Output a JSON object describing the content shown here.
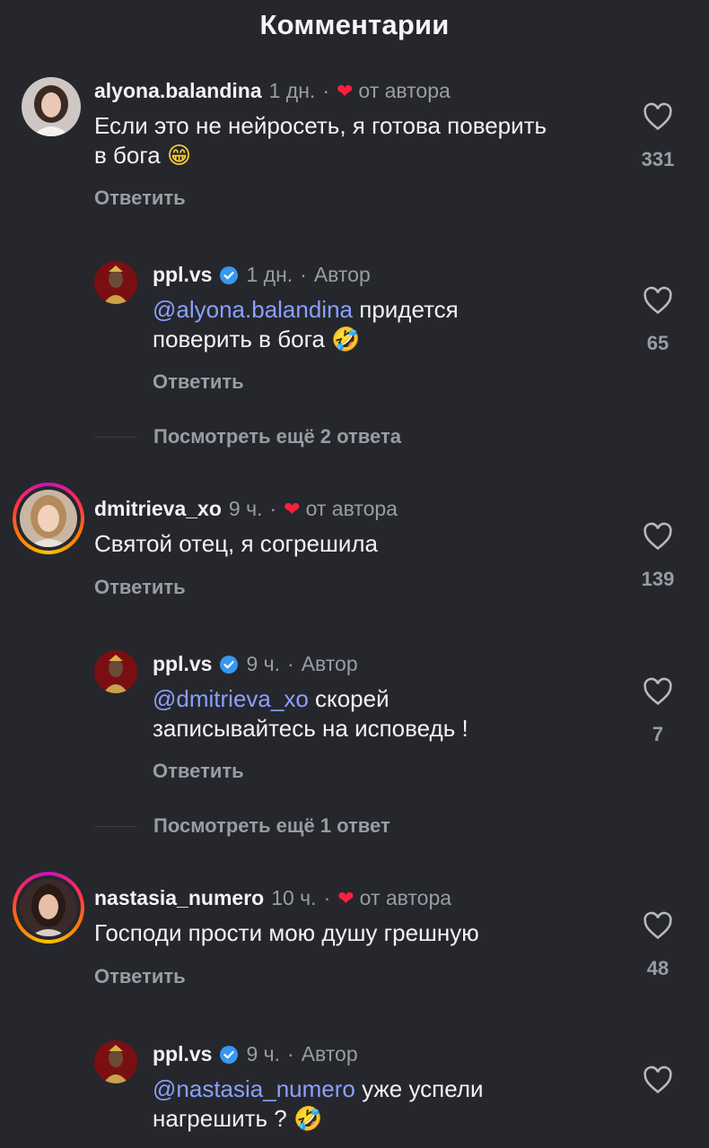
{
  "header": {
    "title": "Комментарии"
  },
  "labels": {
    "reply": "Ответить",
    "author": "Автор",
    "from_author": "от автора"
  },
  "comments": [
    {
      "user": "alyona.balandina",
      "time": "1 дн.",
      "liked_by_author": true,
      "text_line1": "Если это не нейросеть, я готова поверить",
      "text_line2": "в бога",
      "emoji": "😁",
      "likes": "331",
      "reply": {
        "user": "ppl.vs",
        "time": "1 дн.",
        "mention": "@alyona.balandina",
        "text_line1_rest": " придется",
        "text_line2": "поверить в бога",
        "emoji": "🤣",
        "likes": "65"
      },
      "more": "Посмотреть ещё 2 ответа"
    },
    {
      "user": "dmitrieva_xo",
      "time": "9 ч.",
      "liked_by_author": true,
      "text_line1": "Святой отец, я согрешила",
      "likes": "139",
      "reply": {
        "user": "ppl.vs",
        "time": "9 ч.",
        "mention": "@dmitrieva_xo",
        "text_line1_rest": " скорей",
        "text_line2": "записывайтесь на исповедь !",
        "likes": "7"
      },
      "more": "Посмотреть ещё 1 ответ"
    },
    {
      "user": "nastasia_numero",
      "time": "10 ч.",
      "liked_by_author": true,
      "text_line1": "Господи прости мою душу грешную",
      "likes": "48",
      "reply": {
        "user": "ppl.vs",
        "time": "9 ч.",
        "mention": "@nastasia_numero",
        "text_line1_rest": " уже успели",
        "text_line2": "нагрешить ?",
        "emoji": "🤣"
      }
    }
  ],
  "colors": {
    "background": "#25272c",
    "mention": "#8aa0ff",
    "heart": "#ff1f3d",
    "verified": "#3897f0"
  }
}
